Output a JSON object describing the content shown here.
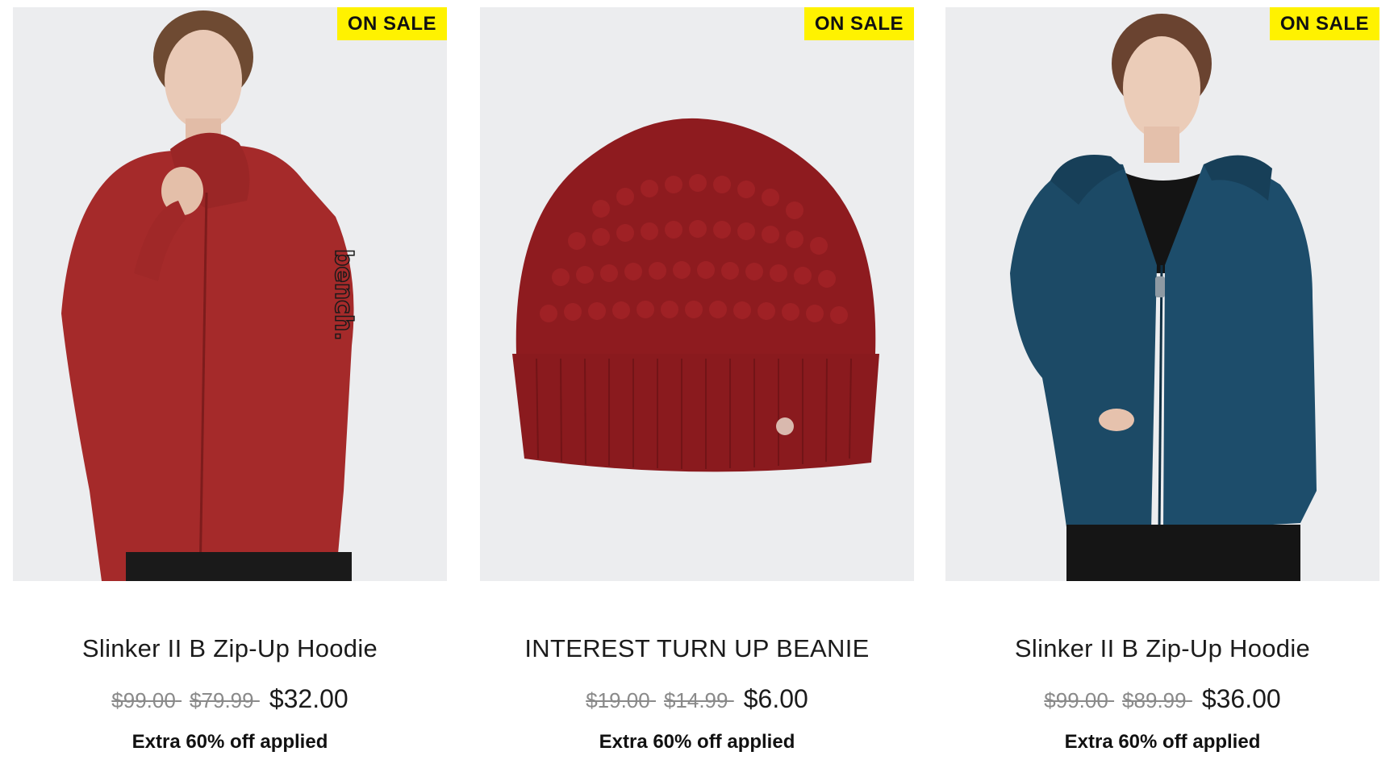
{
  "products": [
    {
      "badge": "ON SALE",
      "name": "Slinker II B Zip-Up Hoodie",
      "original_price": "$99.00",
      "previous_price": "$79.99",
      "sale_price": "$32.00",
      "promo": "Extra 60% off applied",
      "image": "model-red-zip-hoodie",
      "garment_color": "#a52a2a"
    },
    {
      "badge": "ON SALE",
      "name": "INTEREST TURN UP BEANIE",
      "original_price": "$19.00",
      "previous_price": "$14.99",
      "sale_price": "$6.00",
      "promo": "Extra 60% off applied",
      "image": "red-knit-beanie",
      "garment_color": "#8e1b1f"
    },
    {
      "badge": "ON SALE",
      "name": "Slinker II B Zip-Up Hoodie",
      "original_price": "$99.00",
      "previous_price": "$89.99",
      "sale_price": "$36.00",
      "promo": "Extra 60% off applied",
      "image": "model-teal-zip-hoodie",
      "garment_color": "#1c4a66"
    }
  ],
  "colors": {
    "badge_bg": "#fff200",
    "image_bg": "#ecedef",
    "strike_text": "#8a8a8a",
    "text": "#1b1b1b"
  }
}
